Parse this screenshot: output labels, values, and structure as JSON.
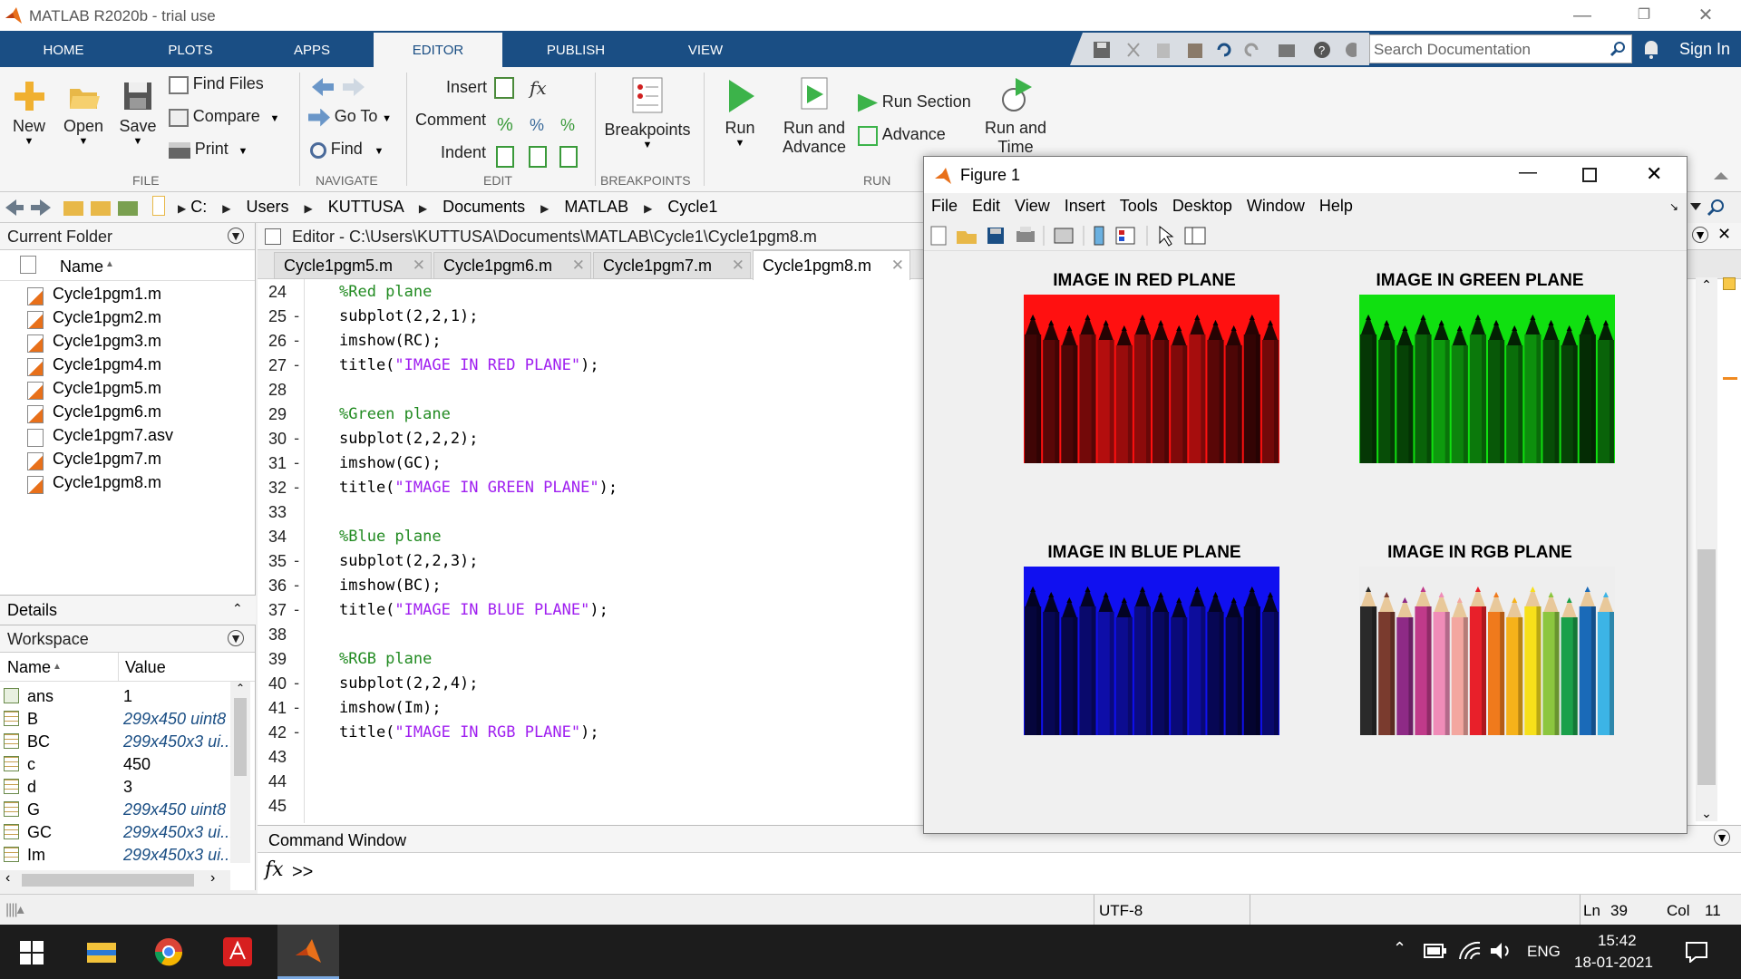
{
  "window": {
    "title": "MATLAB R2020b - trial use"
  },
  "ribbon_tabs": [
    "HOME",
    "PLOTS",
    "APPS",
    "EDITOR",
    "PUBLISH",
    "VIEW"
  ],
  "search": {
    "placeholder": "Search Documentation"
  },
  "sign_in": "Sign In",
  "toolstrip": {
    "file": {
      "new": "New",
      "open": "Open",
      "save": "Save",
      "find_files": "Find Files",
      "compare": "Compare",
      "print": "Print",
      "section": "FILE"
    },
    "navigate": {
      "go_to": "Go To",
      "find": "Find",
      "section": "NAVIGATE"
    },
    "edit": {
      "insert": "Insert",
      "comment": "Comment",
      "indent": "Indent",
      "section": "EDIT"
    },
    "breakpoints": {
      "label": "Breakpoints",
      "section": "BREAKPOINTS"
    },
    "run": {
      "run": "Run",
      "run_and_advance_1": "Run and",
      "run_and_advance_2": "Advance",
      "run_section": "Run Section",
      "advance": "Advance",
      "run_and_time_1": "Run and",
      "run_and_time_2": "Time",
      "section": "RUN"
    }
  },
  "address": [
    "C:",
    "Users",
    "KUTTUSA",
    "Documents",
    "MATLAB",
    "Cycle1"
  ],
  "current_folder": {
    "title": "Current Folder",
    "column_name": "Name",
    "files": [
      "Cycle1pgm1.m",
      "Cycle1pgm2.m",
      "Cycle1pgm3.m",
      "Cycle1pgm4.m",
      "Cycle1pgm5.m",
      "Cycle1pgm6.m",
      "Cycle1pgm7.asv",
      "Cycle1pgm7.m",
      "Cycle1pgm8.m"
    ]
  },
  "details": {
    "title": "Details"
  },
  "workspace": {
    "title": "Workspace",
    "col_name": "Name",
    "col_value": "Value",
    "rows": [
      {
        "name": "ans",
        "value": "1"
      },
      {
        "name": "B",
        "value": "299x450 uint8"
      },
      {
        "name": "BC",
        "value": "299x450x3 ui..."
      },
      {
        "name": "c",
        "value": "450"
      },
      {
        "name": "d",
        "value": "3"
      },
      {
        "name": "G",
        "value": "299x450 uint8"
      },
      {
        "name": "GC",
        "value": "299x450x3 ui..."
      },
      {
        "name": "Im",
        "value": "299x450x3 ui..."
      }
    ]
  },
  "editor": {
    "title": "Editor - C:\\Users\\KUTTUSA\\Documents\\MATLAB\\Cycle1\\Cycle1pgm8.m",
    "tabs": [
      "Cycle1pgm5.m",
      "Cycle1pgm6.m",
      "Cycle1pgm7.m",
      "Cycle1pgm8.m"
    ],
    "lines": [
      {
        "n": "24",
        "dash": "",
        "code": "%Red plane"
      },
      {
        "n": "25",
        "dash": "-",
        "code": "subplot(2,2,1);"
      },
      {
        "n": "26",
        "dash": "-",
        "code": "imshow(RC);"
      },
      {
        "n": "27",
        "dash": "-",
        "code": "title(\"IMAGE IN RED PLANE\");"
      },
      {
        "n": "28",
        "dash": "",
        "code": ""
      },
      {
        "n": "29",
        "dash": "",
        "code": "%Green plane"
      },
      {
        "n": "30",
        "dash": "-",
        "code": "subplot(2,2,2);"
      },
      {
        "n": "31",
        "dash": "-",
        "code": "imshow(GC);"
      },
      {
        "n": "32",
        "dash": "-",
        "code": "title(\"IMAGE IN GREEN PLANE\");"
      },
      {
        "n": "33",
        "dash": "",
        "code": ""
      },
      {
        "n": "34",
        "dash": "",
        "code": "%Blue plane"
      },
      {
        "n": "35",
        "dash": "-",
        "code": "subplot(2,2,3);"
      },
      {
        "n": "36",
        "dash": "-",
        "code": "imshow(BC);"
      },
      {
        "n": "37",
        "dash": "-",
        "code": "title(\"IMAGE IN BLUE PLANE\");"
      },
      {
        "n": "38",
        "dash": "",
        "code": ""
      },
      {
        "n": "39",
        "dash": "",
        "code": "%RGB plane"
      },
      {
        "n": "40",
        "dash": "-",
        "code": "subplot(2,2,4);"
      },
      {
        "n": "41",
        "dash": "-",
        "code": "imshow(Im);"
      },
      {
        "n": "42",
        "dash": "-",
        "code": "title(\"IMAGE IN RGB PLANE\");"
      },
      {
        "n": "43",
        "dash": "",
        "code": ""
      },
      {
        "n": "44",
        "dash": "",
        "code": ""
      },
      {
        "n": "45",
        "dash": "",
        "code": ""
      }
    ]
  },
  "command_window": {
    "title": "Command Window",
    "fx": "fx",
    "prompt": ">>"
  },
  "figure": {
    "title": "Figure 1",
    "menu": [
      "File",
      "Edit",
      "View",
      "Insert",
      "Tools",
      "Desktop",
      "Window",
      "Help"
    ],
    "plots": [
      {
        "title": "IMAGE IN RED PLANE",
        "tint": "#ff1010"
      },
      {
        "title": "IMAGE IN GREEN PLANE",
        "tint": "#10e010"
      },
      {
        "title": "IMAGE IN BLUE PLANE",
        "tint": "#1010f0"
      },
      {
        "title": "IMAGE IN RGB PLANE",
        "tint": "rgb"
      }
    ]
  },
  "status": {
    "encoding": "UTF-8",
    "ln_label": "Ln",
    "ln": "39",
    "col_label": "Col",
    "col": "11"
  },
  "taskbar": {
    "lang": "ENG",
    "time": "15:42",
    "date": "18-01-2021"
  },
  "colors": {
    "tabbar": "#1a4e84",
    "accent": "#1a4e84",
    "comment": "#228b22",
    "string": "#a020f0"
  }
}
